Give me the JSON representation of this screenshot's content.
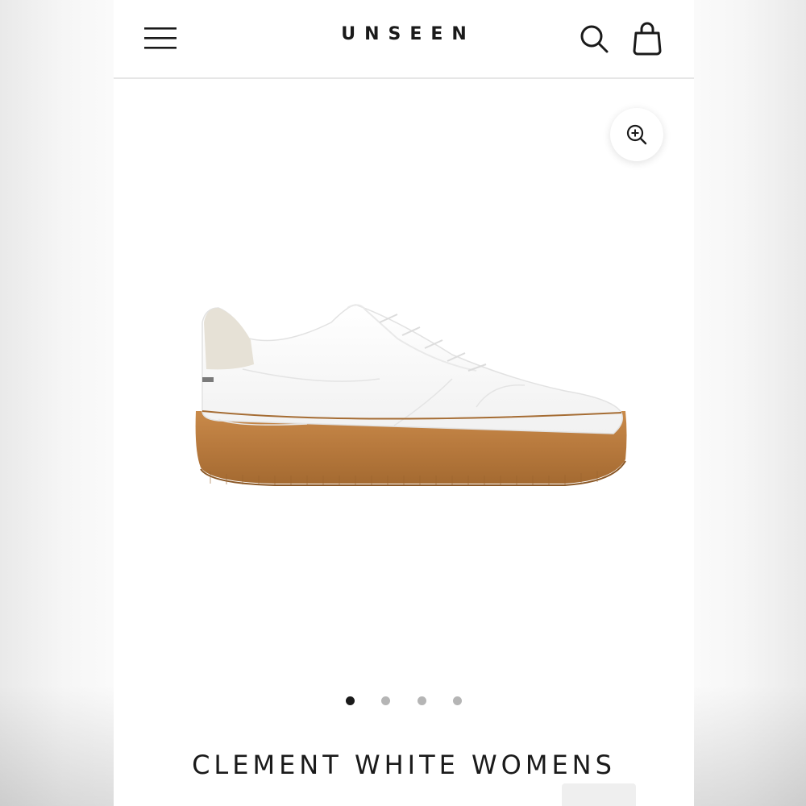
{
  "header": {
    "logo": "UNSEEN",
    "menu_icon": "hamburger-menu-icon",
    "search_icon": "search-icon",
    "cart_icon": "shopping-bag-icon"
  },
  "gallery": {
    "zoom_icon": "zoom-in-icon",
    "image_description_icon": "sneaker-image",
    "slide_count": 4,
    "active_slide": 1
  },
  "product": {
    "title": "CLEMENT WHITE WOMENS"
  },
  "colors": {
    "text": "#1a1a1a",
    "divider": "#e6e6e6",
    "dot_inactive": "#b5b5b5",
    "sole": "#b7793d"
  }
}
